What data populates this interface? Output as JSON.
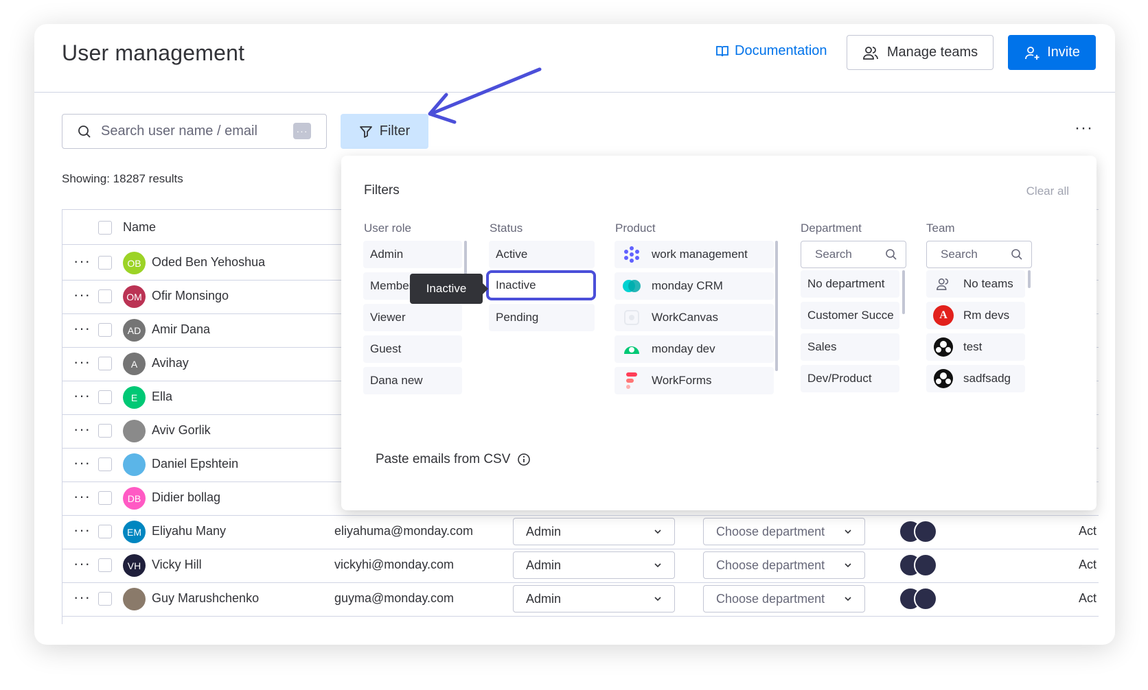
{
  "header": {
    "title": "User management",
    "documentation": "Documentation",
    "manage_teams": "Manage teams",
    "invite": "Invite"
  },
  "toolbar": {
    "search_placeholder": "Search user name / email",
    "filter_label": "Filter",
    "more": "···",
    "showing": "Showing: 18287 results"
  },
  "table": {
    "name_header": "Name",
    "rows": [
      {
        "initials": "OB",
        "name": "Oded Ben Yehoshua",
        "color": "#9cd326"
      },
      {
        "initials": "OM",
        "name": "Ofir Monsingo",
        "color": "#bb3354"
      },
      {
        "initials": "AD",
        "name": "Amir Dana",
        "color": "#757575"
      },
      {
        "initials": "A",
        "name": "Avihay",
        "color": "#757575"
      },
      {
        "initials": "E",
        "name": "Ella",
        "color": "#00c875"
      },
      {
        "initials": "",
        "name": "Aviv Gorlik",
        "color": "#8a8a8a"
      },
      {
        "initials": "",
        "name": "Daniel Epshtein",
        "color": "#5bb5e8"
      },
      {
        "initials": "DB",
        "name": "Didier bollag",
        "color": "#ff5ac4"
      },
      {
        "initials": "EM",
        "name": "Eliyahu Many",
        "email": "eliyahuma@monday.com",
        "role": "Admin",
        "dept": "Choose department",
        "status": "Act",
        "color": "#0086c0"
      },
      {
        "initials": "VH",
        "name": "Vicky Hill",
        "email": "vickyhi@monday.com",
        "role": "Admin",
        "dept": "Choose department",
        "status": "Act",
        "color": "#1f1f3b"
      },
      {
        "initials": "",
        "name": "Guy Marushchenko",
        "email": "guyma@monday.com",
        "role": "Admin",
        "dept": "Choose department",
        "status": "Act",
        "color": "#8a7a6a"
      }
    ]
  },
  "filters": {
    "title": "Filters",
    "clear_all": "Clear all",
    "user_role": {
      "label": "User role",
      "options": [
        "Admin",
        "Member",
        "Viewer",
        "Guest",
        "Dana new"
      ]
    },
    "status": {
      "label": "Status",
      "options": [
        "Active",
        "Inactive",
        "Pending"
      ]
    },
    "product": {
      "label": "Product",
      "options": [
        "work management",
        "monday CRM",
        "WorkCanvas",
        "monday dev",
        "WorkForms"
      ]
    },
    "department": {
      "label": "Department",
      "search": "Search",
      "options": [
        "No department",
        "Customer Succe",
        "Sales",
        "Dev/Product"
      ]
    },
    "team": {
      "label": "Team",
      "search": "Search",
      "options": [
        "No teams",
        "Rm devs",
        "test",
        "sadfsadg"
      ]
    },
    "tooltip": "Inactive",
    "paste_csv": "Paste emails from CSV"
  },
  "colors": {
    "accent": "#0073ea",
    "selection": "#4b4fd9",
    "filter_bg": "#cce5ff"
  }
}
